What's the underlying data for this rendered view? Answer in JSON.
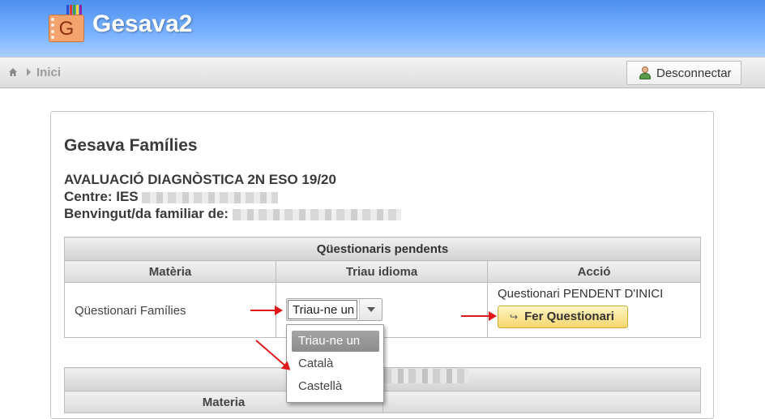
{
  "app": {
    "title": "Gesava2",
    "logo_letter": "G"
  },
  "navbar": {
    "breadcrumb": "Inici",
    "logout_label": "Desconnectar"
  },
  "panel": {
    "title": "Gesava Famílies",
    "line1": "AVALUACIÓ DIAGNÒSTICA 2N ESO 19/20",
    "line2": "Centre: IES",
    "line3": "Benvingut/da familiar de:"
  },
  "pending_table": {
    "caption": "Qüestionaris pendents",
    "headers": [
      "Matèria",
      "Triau idioma",
      "Acció"
    ],
    "row": {
      "subject": "Qüestionari Famílies",
      "select_value": "Triau-ne un",
      "status": "Questionari PENDENT D'INICI",
      "action": "Fer Questionari"
    }
  },
  "language_dropdown": {
    "options": [
      "Triau-ne un",
      "Català",
      "Castellà"
    ],
    "selected": "Triau-ne un"
  },
  "second_table": {
    "header": "Materia"
  },
  "colors": {
    "header": "#4d8ff0",
    "arrow": "#e0191b",
    "button": "#f6d66d"
  }
}
